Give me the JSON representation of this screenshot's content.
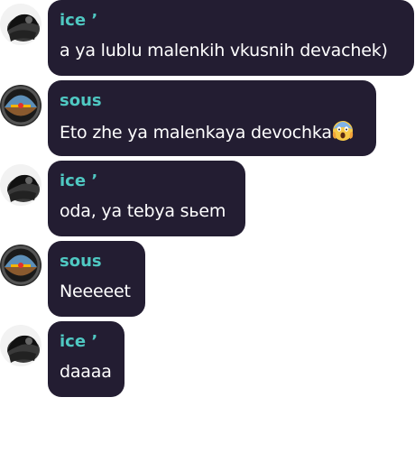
{
  "messages": [
    {
      "author": "ice ’",
      "text": "a ya lublu malenkih vkusnih devachek)",
      "avatar_icon": "car-seat-avatar-icon"
    },
    {
      "author": "sous",
      "text": "Eto zhe ya malenkaya devochka",
      "emoji": "screaming-face-emoji-icon",
      "avatar_icon": "cockpit-gauge-avatar-icon"
    },
    {
      "author": "ice ’",
      "text": "oda, ya tebya sьem",
      "avatar_icon": "car-seat-avatar-icon"
    },
    {
      "author": "sous",
      "text": "Neeeeet",
      "avatar_icon": "cockpit-gauge-avatar-icon"
    },
    {
      "author": "ice ’",
      "text": "daaaa",
      "avatar_icon": "car-seat-avatar-icon"
    }
  ],
  "colors": {
    "bubble_background": "#231d32",
    "author_name": "#4fc8c2",
    "message_text": "#ffffff",
    "page_background": "#ffffff"
  }
}
